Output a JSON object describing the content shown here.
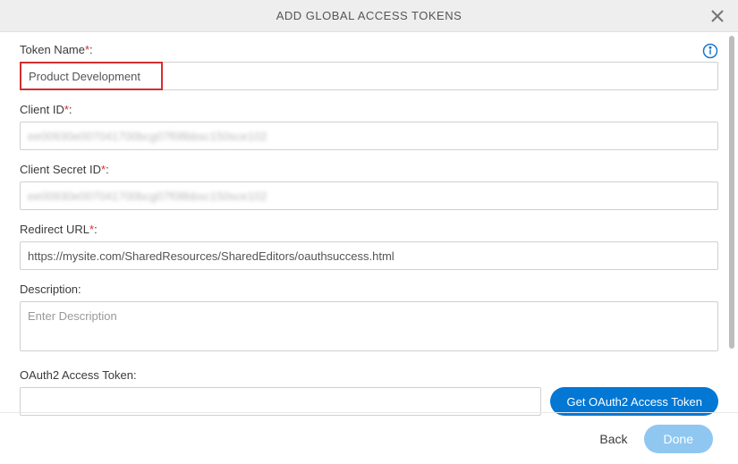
{
  "header": {
    "title": "ADD GLOBAL ACCESS TOKENS"
  },
  "fields": {
    "token_name": {
      "label": "Token Name",
      "required": "*",
      "colon": ":",
      "value": "Product Development"
    },
    "client_id": {
      "label": "Client ID",
      "required": "*",
      "colon": ":",
      "masked": "ee00930e007041700bcg07f08bbsc150sce102"
    },
    "client_secret": {
      "label": "Client Secret ID",
      "required": "*",
      "colon": ":",
      "masked": "ee00930e007041700bcg07f08bbsc150sce102"
    },
    "redirect_url": {
      "label": "Redirect URL",
      "required": "*",
      "colon": ":",
      "value": "https://mysite.com/SharedResources/SharedEditors/oauthsuccess.html"
    },
    "description": {
      "label": "Description",
      "colon": ":",
      "placeholder": "Enter Description"
    },
    "oauth_token": {
      "label": "OAuth2 Access Token",
      "colon": ":",
      "button": "Get OAuth2 Access Token"
    }
  },
  "footer": {
    "back": "Back",
    "done": "Done"
  }
}
